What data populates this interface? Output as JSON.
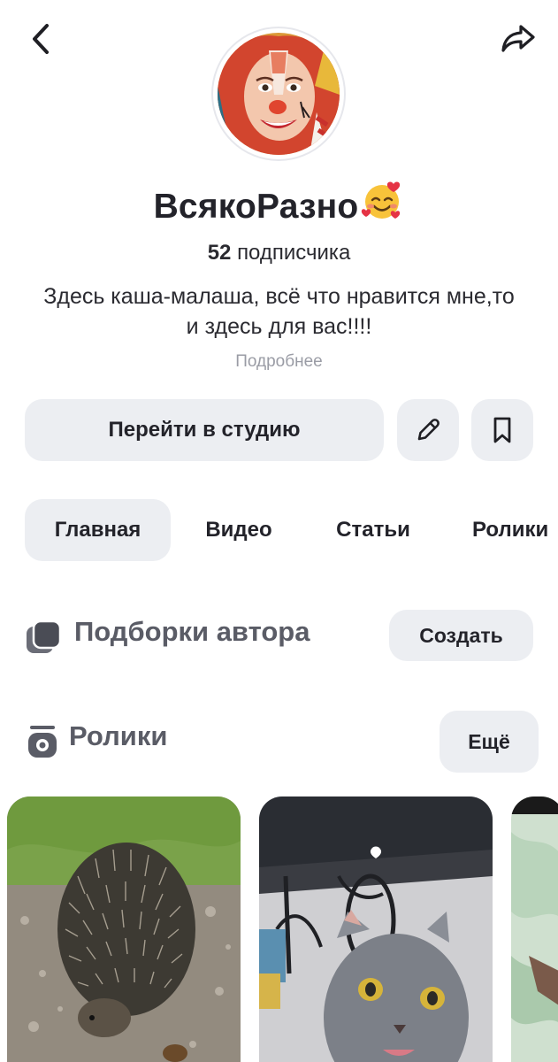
{
  "header": {
    "back_icon": "chevron-left-icon",
    "share_icon": "share-arrow-icon"
  },
  "profile": {
    "name": "ВсякоРазно",
    "name_emoji": "smiling-face-with-hearts",
    "subscribers_count": "52",
    "subscribers_label": "подписчика",
    "description": "Здесь каша-малаша, всё что нравится мне,то и здесь для вас!!!!",
    "more_link": "Подробнее"
  },
  "actions": {
    "studio_label": "Перейти в студию",
    "edit_icon": "pencil-icon",
    "bookmark_icon": "bookmark-icon"
  },
  "tabs": [
    {
      "label": "Главная",
      "active": true
    },
    {
      "label": "Видео",
      "active": false
    },
    {
      "label": "Статьи",
      "active": false
    },
    {
      "label": "Ролики",
      "active": false
    }
  ],
  "collections": {
    "title": "Подборки автора",
    "create_label": "Создать",
    "icon": "collections-icon"
  },
  "reels": {
    "title": "Ролики",
    "more_label": "Ещё",
    "icon": "reels-icon",
    "items": [
      {
        "subject": "hedgehog"
      },
      {
        "subject": "cat"
      },
      {
        "subject": "cropped"
      }
    ]
  },
  "colors": {
    "button_bg": "#eceef2",
    "text": "#23232a",
    "muted": "#9a9ca5"
  }
}
